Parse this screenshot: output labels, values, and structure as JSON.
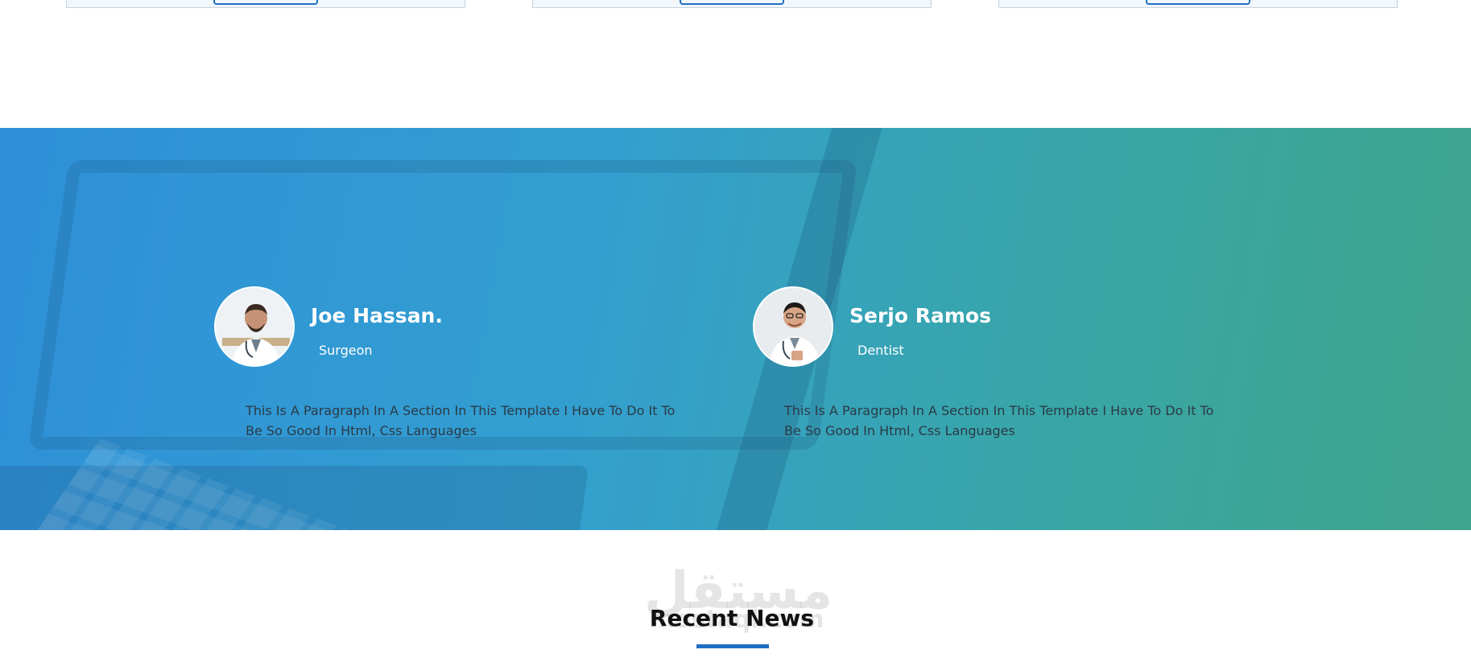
{
  "testimonials": [
    {
      "name": "Joe Hassan.",
      "role": "Surgeon",
      "quote": "This Is A Paragraph In A Section In This Template I Have To Do It To Be So Good In Html, Css Languages"
    },
    {
      "name": "Serjo Ramos",
      "role": "Dentist",
      "quote": "This Is A Paragraph In A Section In This Template I Have To Do It To Be So Good In Html, Css Languages"
    }
  ],
  "recent_news": {
    "title": "Recent News"
  },
  "watermark": {
    "arabic": "مستقل",
    "latin": "mostaql.com"
  },
  "colors": {
    "band_start": "#2e90d8",
    "band_end": "#40a48c",
    "accent": "#1f6fc4"
  }
}
